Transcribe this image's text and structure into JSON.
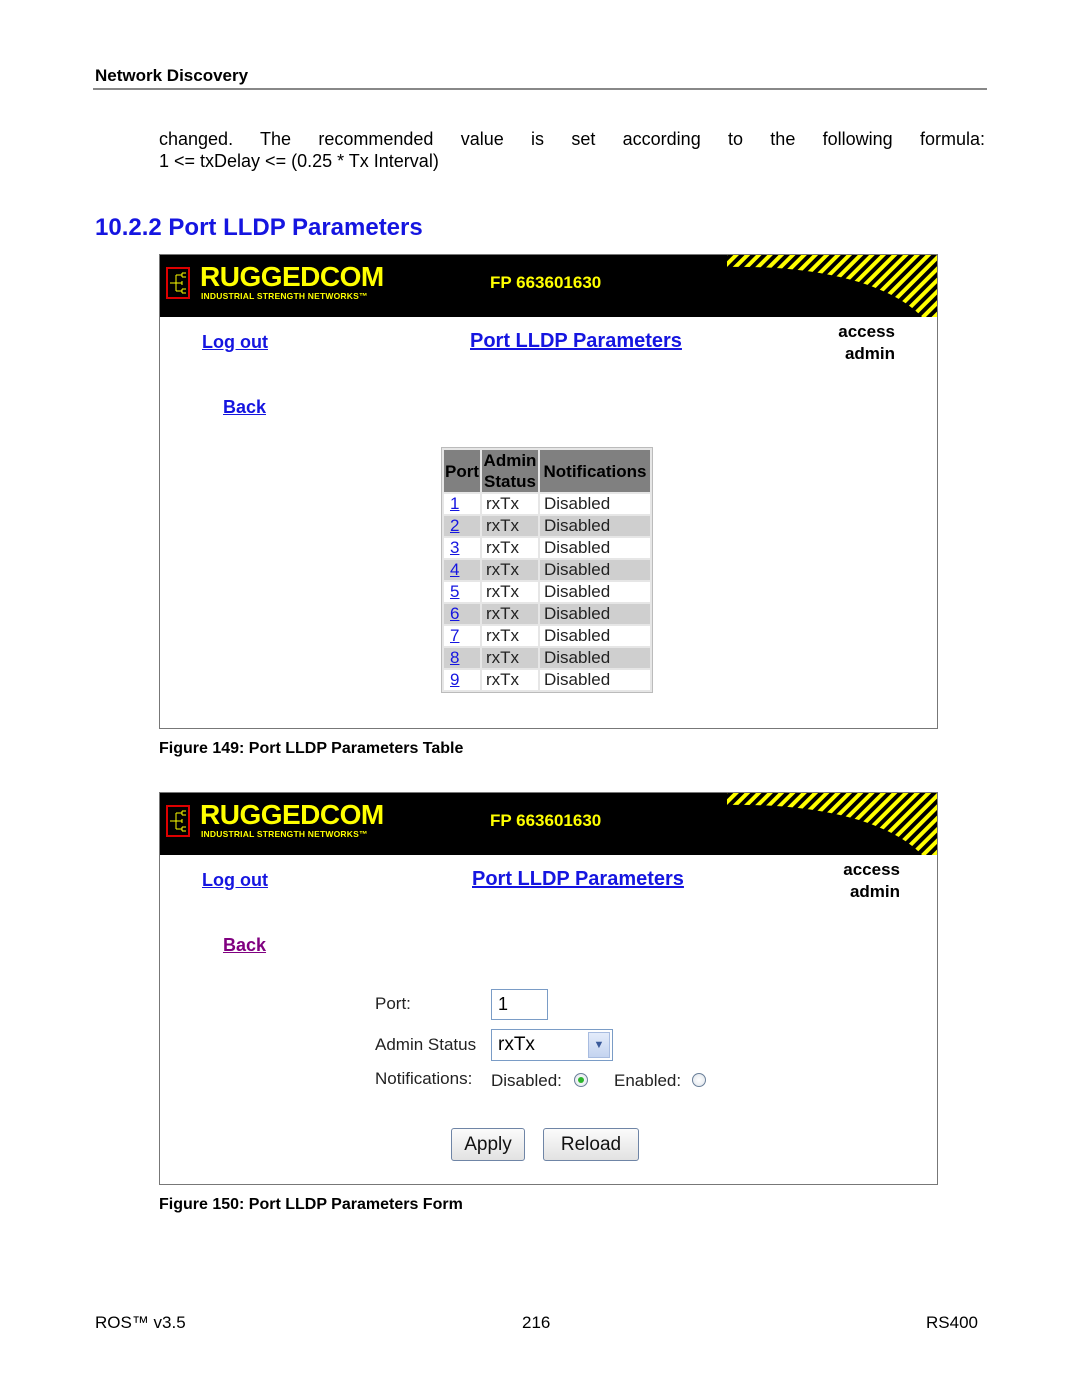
{
  "page": {
    "section_header": "Network Discovery",
    "paragraph_line1": "changed. The recommended value is set according to the following formula:",
    "paragraph_line2": "1 <= txDelay <= (0.25 * Tx Interval)",
    "heading": "10.2.2 Port LLDP Parameters"
  },
  "banner": {
    "brand": "RUGGEDCOM",
    "tagline": "INDUSTRIAL STRENGTH NETWORKS™",
    "device_id": "FP 663601630",
    "brand_color": "#ffff00"
  },
  "figure1": {
    "logout_label": "Log out",
    "title": "Port LLDP Parameters",
    "access_label": "access",
    "access_value": "admin",
    "back_label": "Back",
    "table": {
      "headers": [
        "Port",
        "Admin Status",
        "Notifications"
      ],
      "header_admin_line1": "Admin",
      "header_admin_line2": "Status",
      "rows": [
        {
          "port": "1",
          "admin_status": "rxTx",
          "notifications": "Disabled"
        },
        {
          "port": "2",
          "admin_status": "rxTx",
          "notifications": "Disabled"
        },
        {
          "port": "3",
          "admin_status": "rxTx",
          "notifications": "Disabled"
        },
        {
          "port": "4",
          "admin_status": "rxTx",
          "notifications": "Disabled"
        },
        {
          "port": "5",
          "admin_status": "rxTx",
          "notifications": "Disabled"
        },
        {
          "port": "6",
          "admin_status": "rxTx",
          "notifications": "Disabled"
        },
        {
          "port": "7",
          "admin_status": "rxTx",
          "notifications": "Disabled"
        },
        {
          "port": "8",
          "admin_status": "rxTx",
          "notifications": "Disabled"
        },
        {
          "port": "9",
          "admin_status": "rxTx",
          "notifications": "Disabled"
        }
      ]
    },
    "caption": "Figure 149: Port LLDP Parameters Table"
  },
  "figure2": {
    "logout_label": "Log out",
    "title": "Port LLDP Parameters",
    "access_label": "access",
    "access_value": "admin",
    "back_label": "Back",
    "form": {
      "port_label": "Port:",
      "port_value": "1",
      "admin_status_label": "Admin Status",
      "admin_status_value": "rxTx",
      "notifications_label": "Notifications:",
      "disabled_label": "Disabled:",
      "enabled_label": "Enabled:",
      "notifications_selected": "Disabled",
      "apply_label": "Apply",
      "reload_label": "Reload"
    },
    "caption": "Figure 150: Port LLDP Parameters Form"
  },
  "footer": {
    "left": "ROS™  v3.5",
    "center": "216",
    "right": "RS400"
  },
  "colors": {
    "link": "#1515e0",
    "visited_link": "#800080",
    "heading": "#1515e0"
  }
}
